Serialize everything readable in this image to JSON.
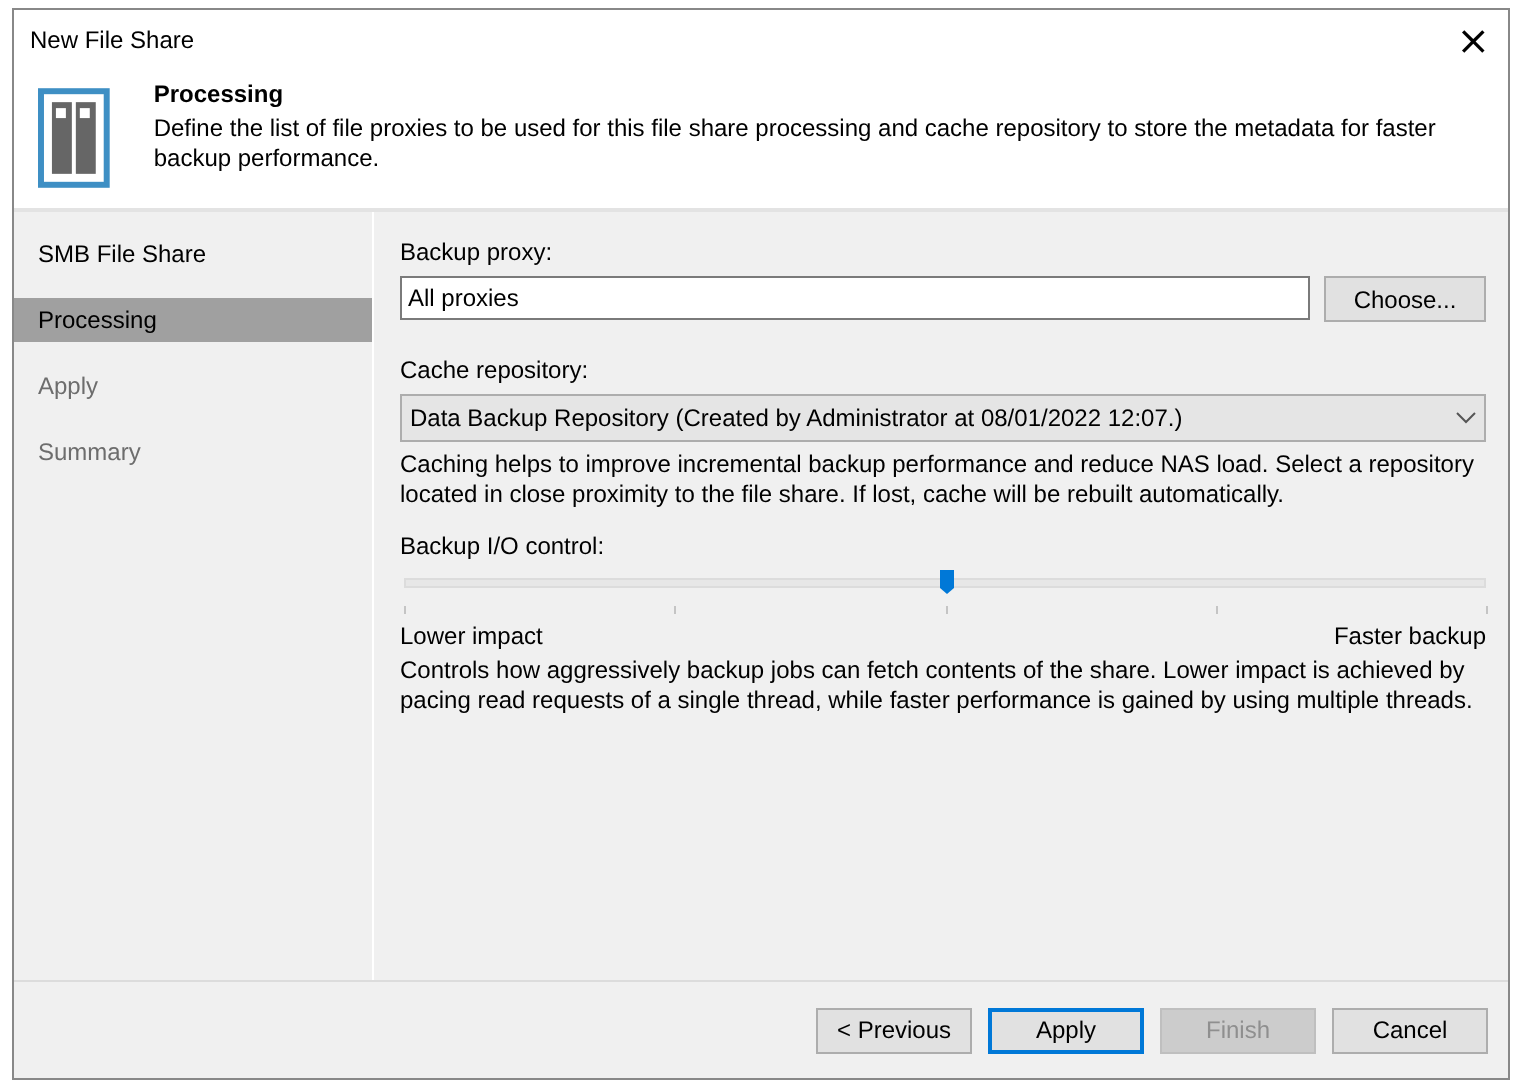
{
  "window": {
    "title": "New File Share",
    "close": "×"
  },
  "header": {
    "title": "Processing",
    "description": "Define the list of file proxies to be used for this file share processing and cache repository to store the metadata for faster backup performance."
  },
  "sidebar": {
    "items": [
      {
        "label": "SMB File Share",
        "selected": false,
        "disabled": false
      },
      {
        "label": "Processing",
        "selected": true,
        "disabled": false
      },
      {
        "label": "Apply",
        "selected": false,
        "disabled": true
      },
      {
        "label": "Summary",
        "selected": false,
        "disabled": true
      }
    ]
  },
  "backup_proxy": {
    "label": "Backup proxy:",
    "value": "All proxies",
    "button": "Choose..."
  },
  "cache_repository": {
    "label": "Cache repository:",
    "value": "Data Backup Repository (Created by Administrator at 08/01/2022 12:07.)",
    "hint": "Caching helps to improve incremental backup performance and reduce NAS load. Select a repository located in close proximity to the file share. If lost, cache will be rebuilt automatically."
  },
  "io_control": {
    "label": "Backup I/O control:",
    "level": 0.5,
    "min_label": "Lower impact",
    "max_label": "Faster backup",
    "hint": "Controls how aggressively backup jobs can fetch contents of the share. Lower impact is achieved by pacing read requests of a single thread, while faster performance is gained by using multiple threads."
  },
  "buttons": [
    {
      "label": "< Previous",
      "default": false,
      "disabled": false
    },
    {
      "label": "Apply",
      "default": true,
      "disabled": false
    },
    {
      "label": "Finish",
      "default": false,
      "disabled": true
    },
    {
      "label": "Cancel",
      "default": false,
      "disabled": false
    }
  ]
}
